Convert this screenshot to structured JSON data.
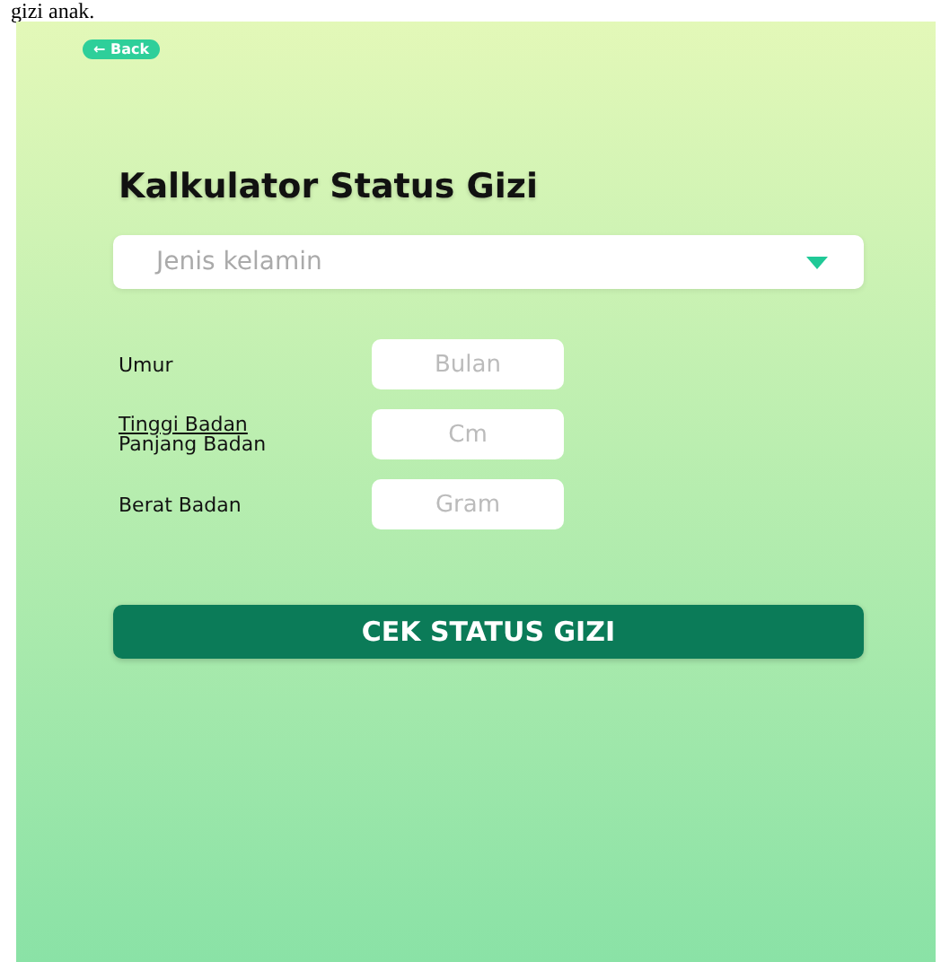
{
  "caption": "gizi anak.",
  "back_button": {
    "label": "← Back"
  },
  "title": "Kalkulator Status Gizi",
  "gender_select": {
    "placeholder": "Jenis kelamin"
  },
  "fields": [
    {
      "labels": [
        {
          "text": "Umur",
          "underlined": false
        }
      ],
      "placeholder": "Bulan"
    },
    {
      "labels": [
        {
          "text": "Tinggi Badan",
          "underlined": true
        },
        {
          "text": "Panjang Badan",
          "underlined": false
        }
      ],
      "placeholder": "Cm"
    },
    {
      "labels": [
        {
          "text": "Berat Badan",
          "underlined": false
        }
      ],
      "placeholder": "Gram"
    }
  ],
  "submit_button": {
    "label": "CEK STATUS GIZI"
  }
}
